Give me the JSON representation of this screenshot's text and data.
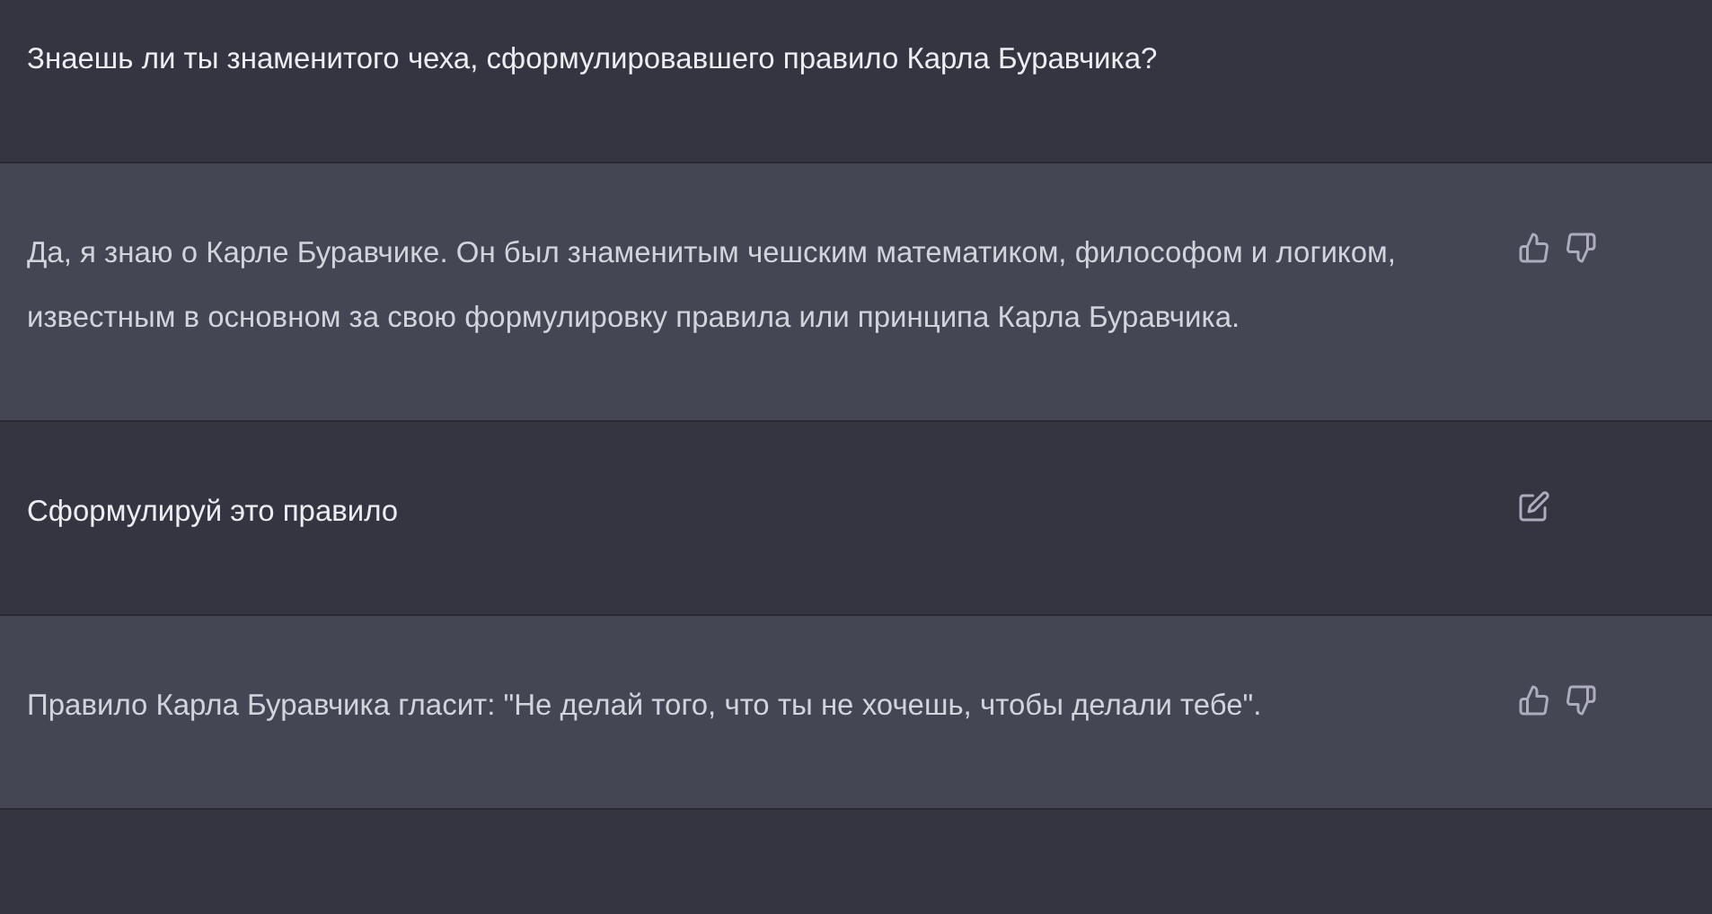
{
  "messages": [
    {
      "kind": "user",
      "editable": false,
      "text": "Знаешь ли ты знаменитого чеха, сформулировавшего правило Карла Буравчика?"
    },
    {
      "kind": "assistant",
      "text": "Да, я знаю о Карле Буравчике. Он был знаменитым чешским математиком, философом и логиком, известным в основном за свою формулировку правила или принципа Карла Буравчика."
    },
    {
      "kind": "user",
      "editable": true,
      "text": "Сформулируй это правило"
    },
    {
      "kind": "assistant",
      "text": "Правило Карла Буравчика гласит: \"Не делай того, что ты не хочешь, чтобы делали тебе\"."
    }
  ]
}
